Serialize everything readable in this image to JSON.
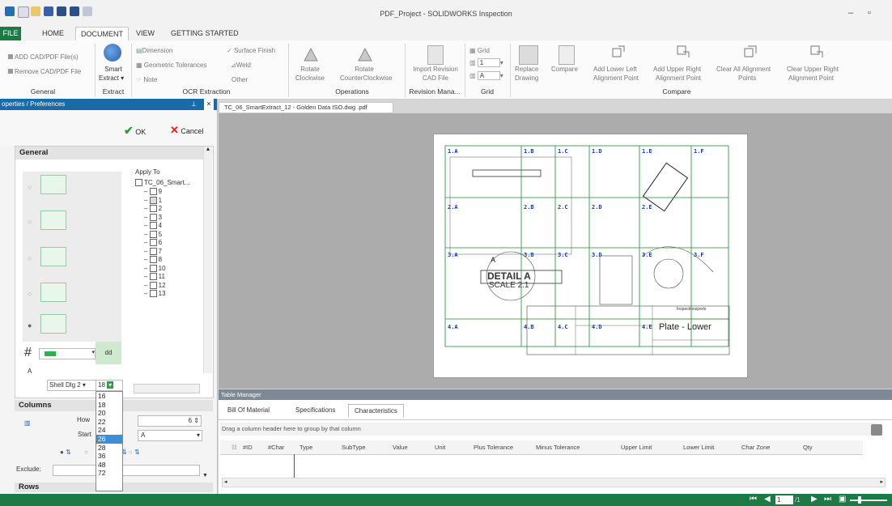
{
  "window": {
    "title": "PDF_Project - SOLIDWORKS Inspection"
  },
  "tabs": [
    "FILE",
    "HOME",
    "DOCUMENT",
    "VIEW",
    "GETTING STARTED"
  ],
  "ribbon": {
    "general": {
      "add": "ADD CAD/PDF File(s)",
      "remove": "Remove CAD/PDF File",
      "label": "General"
    },
    "extract": {
      "smart": "Smart",
      "smart2": "Extract",
      "label": "Extract"
    },
    "ocr": {
      "dimension": "Dimension",
      "geometric": "Geometric Tolerances",
      "weld": "Weld",
      "note": "Note",
      "surface": "Surface Finish",
      "other": "Other",
      "label": "OCR Extraction"
    },
    "operations": {
      "rotcw": "Rotate",
      "rotcw2": "Clockwise",
      "rotccw": "Rotate",
      "rotccw2": "CounterClockwise",
      "label": "Operations"
    },
    "revision": {
      "import": "Import Revision",
      "import2": "CAD File",
      "label": "Revision Mana..."
    },
    "grid": {
      "grid": "Grid",
      "num": "1",
      "alpha": "A",
      "label": "Grid"
    },
    "compare": {
      "replace": "Replace",
      "replace2": "Drawing",
      "compare": "Compare",
      "lowerleft": "Add Lower Left",
      "lowerleft2": "Alignment Point",
      "upperright": "Add Upper Right",
      "upperright2": "Alignment Point",
      "clearall": "Clear All Alignment",
      "clearall2": "Points",
      "clearupper": "Clear Upper Right",
      "clearupper2": "Alignment Point",
      "label": "Compare"
    }
  },
  "properties": {
    "header": "operties / Preferences",
    "ok": "OK",
    "cancel": "Cancel",
    "general": "General",
    "applyTo": "Apply To",
    "tree": [
      "TC_06_Smart...",
      "9",
      "1",
      "2",
      "3",
      "4",
      "5",
      "6",
      "7",
      "8",
      "10",
      "11",
      "12",
      "13"
    ],
    "green_value": "dd",
    "font_name": "Shell Dlg 2",
    "font_size": "18",
    "font_sizes": [
      "16",
      "18",
      "20",
      "22",
      "24",
      "26",
      "28",
      "36",
      "48",
      "72"
    ],
    "selected_size": "26",
    "columns": "Columns",
    "how_label": "How",
    "how_value": "6",
    "start_label": "Start",
    "start_value": "A",
    "exclude_label": "Exclude:",
    "rows": "Rows"
  },
  "document": {
    "tab": "TC_06_SmartExtract_12 - Golden Data ISO.dwg .pdf",
    "cells_r1": [
      "1.A",
      "1.B",
      "1.C",
      "1.D",
      "1.E",
      "1.F"
    ],
    "cells_r2": [
      "2.A",
      "2.B",
      "2.C",
      "2.D",
      "2.E"
    ],
    "cells_r3": [
      "3.A",
      "3.B",
      "3.C",
      "3.D",
      "3.E",
      "3.F"
    ],
    "cells_r4": [
      "4.A",
      "4.B",
      "4.C",
      "4.D",
      "4.E"
    ],
    "detail": "DETAIL A",
    "scale": "SCALE 2:1",
    "detail_letter": "A",
    "title_text": "Plate - Lower",
    "block_label": "Inspectionxperts"
  },
  "tableManager": {
    "header": "Table Manager",
    "tabs": [
      "Bill Of Material",
      "Specifications",
      "Characteristics"
    ],
    "groupHint": "Drag a column header here to group by that column",
    "columns": [
      "#ID",
      "#Char",
      "Type",
      "SubType",
      "Value",
      "Unit",
      "Plus Tolerance",
      "Minus Tolerance",
      "Upper Limit",
      "Lower Limit",
      "Char Zone",
      "Qty"
    ]
  },
  "status": {
    "page": "1",
    "of": "/1"
  },
  "colors": {
    "accent": "#1d7a45",
    "grid": "#1e8a3a",
    "blue": "#1a3a9a"
  }
}
